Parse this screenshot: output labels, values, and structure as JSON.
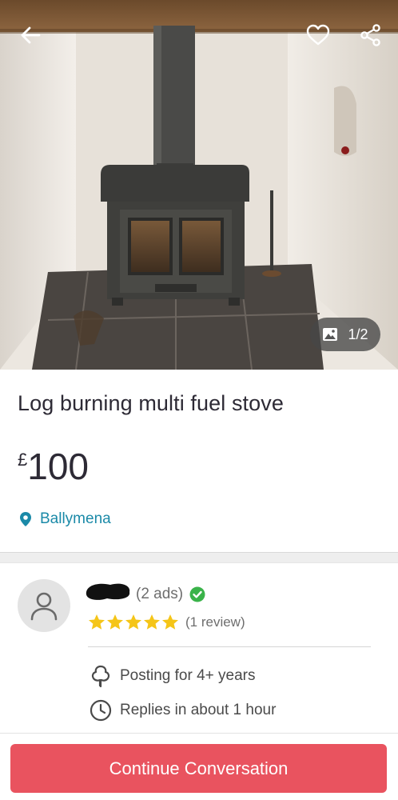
{
  "listing": {
    "title": "Log burning multi fuel stove",
    "price_currency": "£",
    "price_amount": "100",
    "location": "Ballymena"
  },
  "gallery": {
    "counter": "1/2"
  },
  "header": {
    "icons": [
      "back-arrow-icon",
      "heart-icon",
      "share-icon"
    ]
  },
  "seller": {
    "ads_count": "(2 ads)",
    "verified_icon": "check-circle-icon",
    "rating_stars": 5,
    "reviews": "(1 review)",
    "posting_for": "Posting for 4+ years",
    "replies": "Replies in about 1 hour"
  },
  "actions": {
    "continue_label": "Continue Conversation"
  },
  "colors": {
    "accent_button": "#e9535f",
    "location_link": "#1b8aa8",
    "star": "#f5c518",
    "verified": "#3ab34a"
  }
}
